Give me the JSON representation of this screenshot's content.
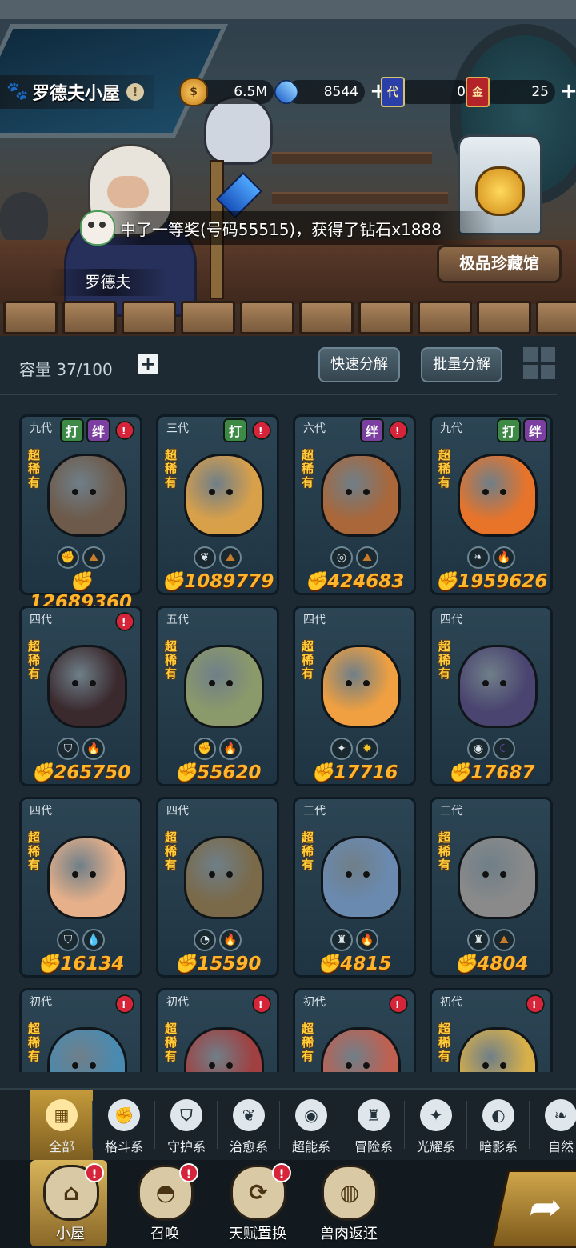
{
  "header": {
    "house_title": "罗德夫小屋",
    "info_icon": "!",
    "gold": "6.5M",
    "diamonds": "8544",
    "ticket_dai_icon": "代",
    "ticket_dai": "0",
    "ticket_jin_icon": "金",
    "ticket_jin": "25",
    "plus": "+"
  },
  "scene": {
    "notification": "中了一等奖(号码55515)，获得了钻石x1888",
    "npc_name": "罗德夫",
    "collection_button": "极品珍藏馆"
  },
  "inventory": {
    "capacity": "容量 37/100",
    "add": "+",
    "quick_decompose": "快速分解",
    "batch_decompose": "批量分解"
  },
  "tag_labels": {
    "da": "打",
    "ban": "绊",
    "warn": "!"
  },
  "rarity_label": "超稀有",
  "cards": [
    {
      "gen": "九代",
      "power": "12689360",
      "tags": [
        "da",
        "ban",
        "warn"
      ],
      "elements": [
        "fist",
        "earth"
      ],
      "color": "#6d5a4a"
    },
    {
      "gen": "三代",
      "power": "1089779",
      "tags": [
        "da",
        "warn"
      ],
      "elements": [
        "leaf",
        "earth"
      ],
      "color": "#d9a04a"
    },
    {
      "gen": "六代",
      "power": "424683",
      "tags": [
        "ban",
        "warn"
      ],
      "elements": [
        "target",
        "earth"
      ],
      "color": "#a9673a"
    },
    {
      "gen": "九代",
      "power": "1959626",
      "tags": [
        "da",
        "ban"
      ],
      "elements": [
        "sprout",
        "fire"
      ],
      "color": "#e8742a"
    },
    {
      "gen": "四代",
      "power": "265750",
      "tags": [
        "warn"
      ],
      "elements": [
        "shield",
        "fire"
      ],
      "color": "#3a2a2e"
    },
    {
      "gen": "五代",
      "power": "55620",
      "tags": [],
      "elements": [
        "fist",
        "fire"
      ],
      "color": "#8b9a6a"
    },
    {
      "gen": "四代",
      "power": "17716",
      "tags": [],
      "elements": [
        "star",
        "sun"
      ],
      "color": "#f0a040"
    },
    {
      "gen": "四代",
      "power": "17687",
      "tags": [],
      "elements": [
        "eye",
        "moon"
      ],
      "color": "#4a4470"
    },
    {
      "gen": "四代",
      "power": "16134",
      "tags": [],
      "elements": [
        "shield",
        "water"
      ],
      "color": "#e6b08a"
    },
    {
      "gen": "四代",
      "power": "15590",
      "tags": [],
      "elements": [
        "psychic",
        "fire"
      ],
      "color": "#7a6a4a"
    },
    {
      "gen": "三代",
      "power": "4815",
      "tags": [],
      "elements": [
        "adventure",
        "fire"
      ],
      "color": "#6a8ab0"
    },
    {
      "gen": "三代",
      "power": "4804",
      "tags": [],
      "elements": [
        "adventure",
        "earth"
      ],
      "color": "#8a8a8a"
    },
    {
      "gen": "初代",
      "power": "",
      "tags": [
        "warn"
      ],
      "elements": [],
      "color": "#4a8ab0"
    },
    {
      "gen": "初代",
      "power": "",
      "tags": [
        "warn"
      ],
      "elements": [],
      "color": "#a04040"
    },
    {
      "gen": "初代",
      "power": "",
      "tags": [
        "warn"
      ],
      "elements": [],
      "color": "#c06050"
    },
    {
      "gen": "初代",
      "power": "",
      "tags": [
        "warn"
      ],
      "elements": [],
      "color": "#d8b04a"
    }
  ],
  "categories": [
    {
      "label": "全部",
      "icon": "▦",
      "active": true
    },
    {
      "label": "格斗系",
      "icon": "✊"
    },
    {
      "label": "守护系",
      "icon": "⛉"
    },
    {
      "label": "治愈系",
      "icon": "❦"
    },
    {
      "label": "超能系",
      "icon": "◉"
    },
    {
      "label": "冒险系",
      "icon": "♜"
    },
    {
      "label": "光耀系",
      "icon": "✦"
    },
    {
      "label": "暗影系",
      "icon": "◐"
    },
    {
      "label": "自然",
      "icon": "❧"
    }
  ],
  "nav": [
    {
      "label": "小屋",
      "icon": "⌂",
      "badge": "!",
      "active": true
    },
    {
      "label": "召唤",
      "icon": "◓",
      "badge": "!"
    },
    {
      "label": "天赋置换",
      "icon": "⟳",
      "badge": "!"
    },
    {
      "label": "兽肉返还",
      "icon": "◍",
      "badge": ""
    }
  ],
  "nav_arrow": "➦",
  "colors": {
    "accent": "#ffb42a",
    "rarity": "#ffce3a",
    "warn": "#d6243a",
    "da": "#3c8a46",
    "ban": "#7a3fa0"
  }
}
